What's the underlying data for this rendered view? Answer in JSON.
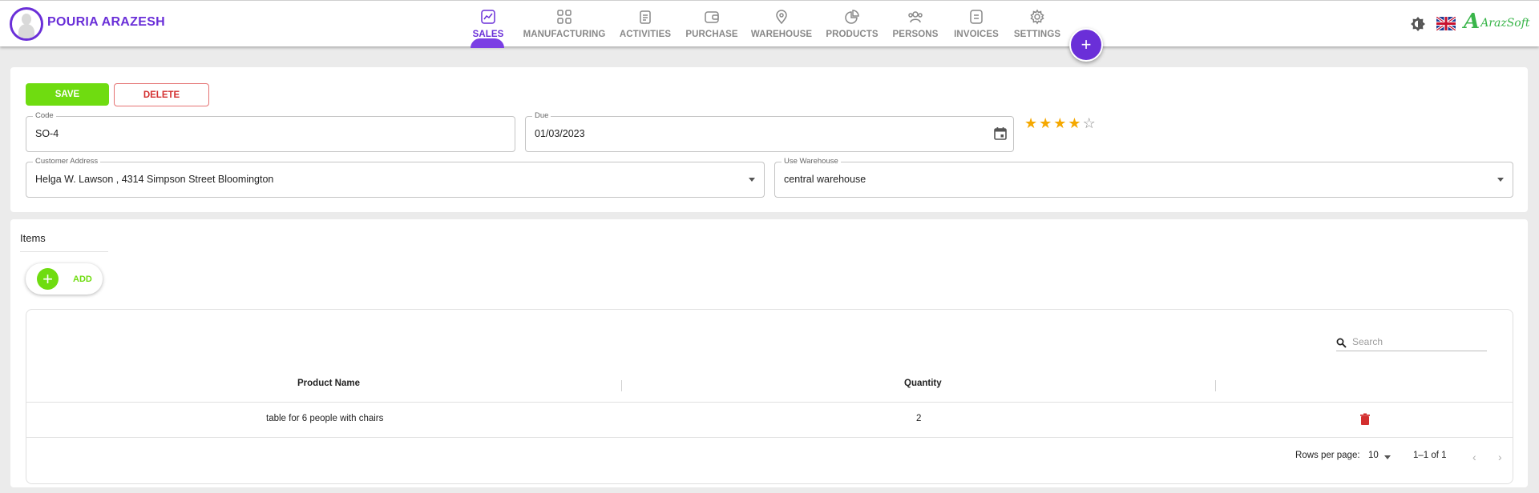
{
  "header": {
    "username": "POURIA ARAZESH",
    "brand_mark": "A",
    "brand_text": "ArazSoft",
    "add_symbol": "+",
    "nav": [
      {
        "label": "SALES",
        "icon": "chart-line-icon",
        "active": true
      },
      {
        "label": "MANUFACTURING",
        "icon": "grid-icon",
        "active": false
      },
      {
        "label": "ACTIVITIES",
        "icon": "clipboard-icon",
        "active": false
      },
      {
        "label": "PURCHASE",
        "icon": "wallet-icon",
        "active": false
      },
      {
        "label": "WAREHOUSE",
        "icon": "location-pin-icon",
        "active": false
      },
      {
        "label": "PRODUCTS",
        "icon": "pie-chart-icon",
        "active": false
      },
      {
        "label": "PERSONS",
        "icon": "people-icon",
        "active": false
      },
      {
        "label": "INVOICES",
        "icon": "document-icon",
        "active": false
      },
      {
        "label": "SETTINGS",
        "icon": "gear-icon",
        "active": false
      }
    ]
  },
  "form": {
    "save_label": "SAVE",
    "delete_label": "DELETE",
    "code": {
      "label": "Code",
      "value": "SO-4"
    },
    "due": {
      "label": "Due",
      "value": "01/03/2023"
    },
    "rating": {
      "value": 4,
      "max": 5,
      "filled_char": "★",
      "empty_char": "☆"
    },
    "customer_address": {
      "label": "Customer Address",
      "value": "Helga W. Lawson , 4314 Simpson Street Bloomington"
    },
    "use_warehouse": {
      "label": "Use Warehouse",
      "value": "central warehouse"
    }
  },
  "items": {
    "title": "Items",
    "add_label": "ADD",
    "add_symbol": "+",
    "search_placeholder": "Search",
    "columns": [
      "Product Name",
      "Quantity"
    ],
    "rows": [
      {
        "product_name": "table for 6 people with chairs",
        "quantity": "2"
      }
    ],
    "rows_per_page_label": "Rows per page:",
    "rows_per_page": "10",
    "range": "1–1 of 1",
    "prev_symbol": "‹",
    "next_symbol": "›"
  },
  "colors": {
    "accent": "#6a2fd8",
    "save": "#6fdc10",
    "delete": "#d32f2f",
    "star": "#f5a800",
    "brand": "#39b54a"
  }
}
